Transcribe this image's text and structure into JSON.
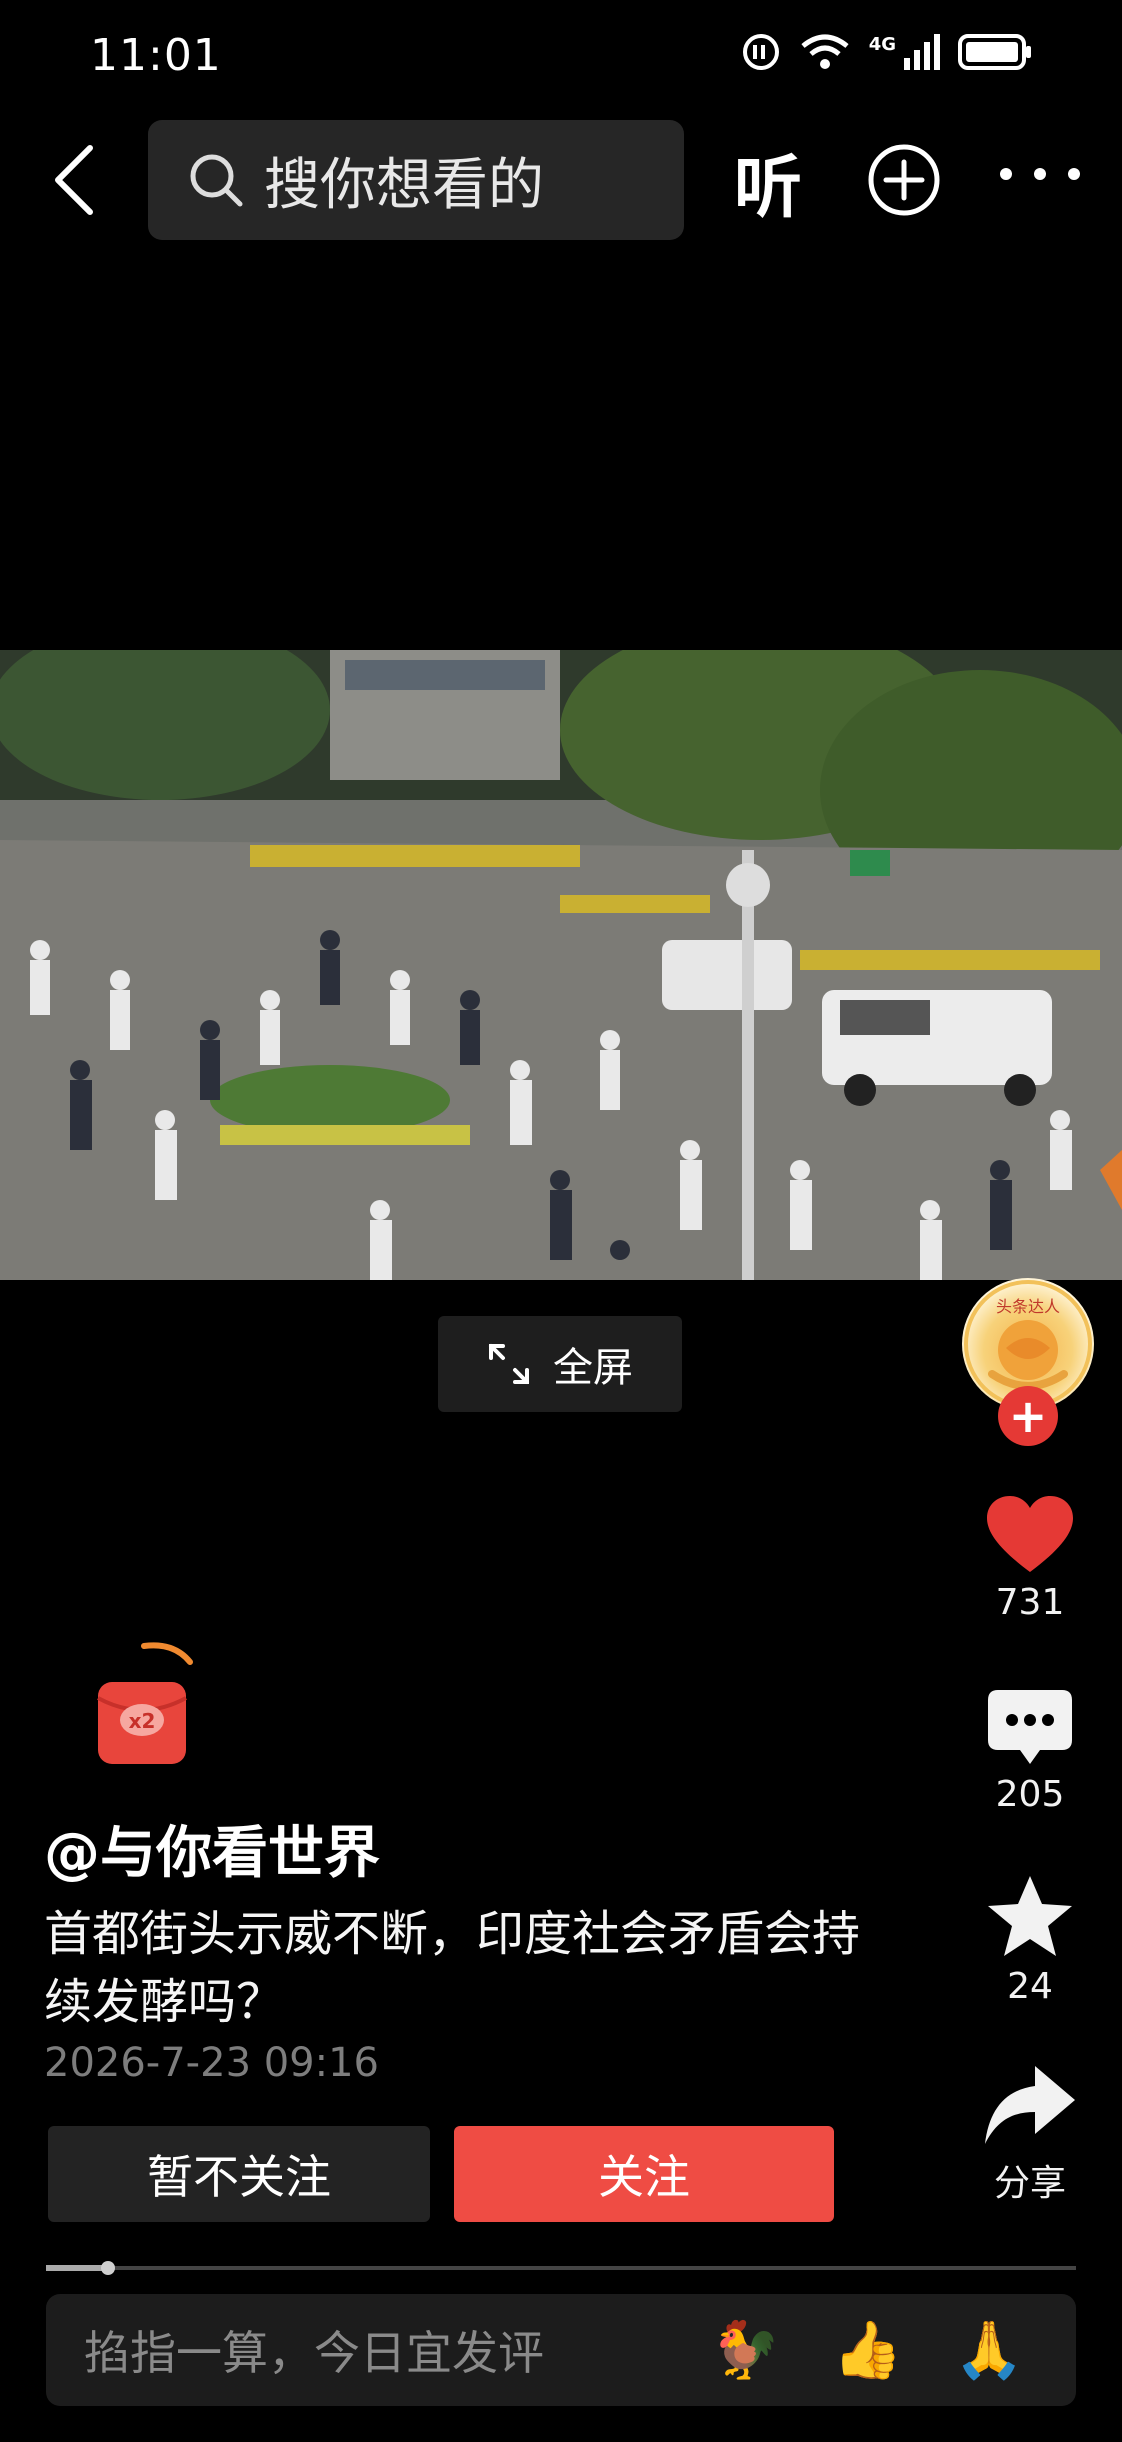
{
  "status_bar": {
    "time": "11:01",
    "network": "4G"
  },
  "nav": {
    "search_placeholder": "搜你想看的",
    "listen_label": "听"
  },
  "video": {
    "fullscreen_label": "全屏"
  },
  "author": {
    "badge_text": "头条达人",
    "name": "@与你看世界"
  },
  "actions": {
    "likes": "731",
    "comments": "205",
    "favorites": "24",
    "share_label": "分享"
  },
  "redpacket": {
    "multiplier": "x2"
  },
  "post": {
    "title": "首都街头示威不断，印度社会矛盾会持续发酵吗？",
    "datetime": "2026-7-23 09:16"
  },
  "buttons": {
    "no_follow": "暂不关注",
    "follow": "关注"
  },
  "progress": {
    "played_fraction": 0.06
  },
  "comment": {
    "placeholder": "掐指一算，今日宜发评",
    "emojis": [
      "🐓",
      "👍",
      "🙏"
    ]
  },
  "colors": {
    "accent_red": "#ef4c44",
    "like_red": "#e53935"
  }
}
